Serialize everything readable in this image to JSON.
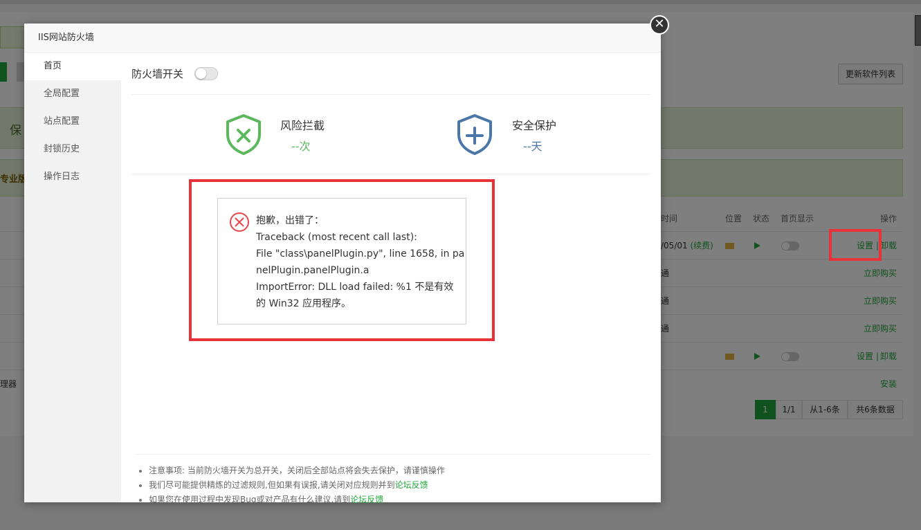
{
  "background": {
    "refresh_button": "更新软件列表",
    "banner_char": "保",
    "pro_label": "专业版",
    "table_headers": {
      "time": "时间",
      "position": "位置",
      "status": "状态",
      "home_display": "首页显示",
      "actions": "操作"
    },
    "rows": [
      {
        "time": "/05/01",
        "renew": "(续费)",
        "action1": "设置",
        "separator": "|",
        "action2": "卸载"
      },
      {
        "time": "通",
        "action": "立即购买"
      },
      {
        "time": "通",
        "action": "立即购买"
      },
      {
        "time": "通",
        "action": "立即购买"
      },
      {
        "action1": "设置",
        "separator": "|",
        "action2": "卸载"
      },
      {
        "left_text": "理器",
        "action": "安装"
      }
    ],
    "pager": {
      "current": "1",
      "pages": "1/1",
      "range": "从1-6条",
      "total": "共6条数据"
    }
  },
  "dialog": {
    "title": "IIS网站防火墙",
    "close_glyph": "✕",
    "sidebar": [
      {
        "label": "首页",
        "active": true
      },
      {
        "label": "全局配置"
      },
      {
        "label": "站点配置"
      },
      {
        "label": "封锁历史"
      },
      {
        "label": "操作日志"
      }
    ],
    "firewall_switch_label": "防火墙开关",
    "stats": [
      {
        "title": "风险拦截",
        "value": "--次",
        "icon": "shield-x-icon",
        "color": "#5cb85c"
      },
      {
        "title": "安全保护",
        "value": "--天",
        "icon": "shield-plus-icon",
        "color": "#4a76a8"
      }
    ],
    "error": {
      "lines": [
        "抱歉，出错了：",
        "Traceback (most recent call last):",
        "File \"class\\panelPlugin.py\", line 1658, in pa",
        "nelPlugin.panelPlugin.a",
        "ImportError: DLL load failed: %1 不是有效",
        "的 Win32 应用程序。"
      ]
    },
    "notes": [
      {
        "text": "注意事项: 当前防火墙开关为总开关，关闭后全部站点将会失去保护，请谨慎操作",
        "link": ""
      },
      {
        "text": "我们尽可能提供精炼的过滤规则,但如果有误报,请关闭对应规则并到",
        "link": "论坛反馈"
      },
      {
        "text": "如果您在使用过程中发现Bug或对产品有什么建议,请到",
        "link": "论坛反馈"
      }
    ]
  }
}
